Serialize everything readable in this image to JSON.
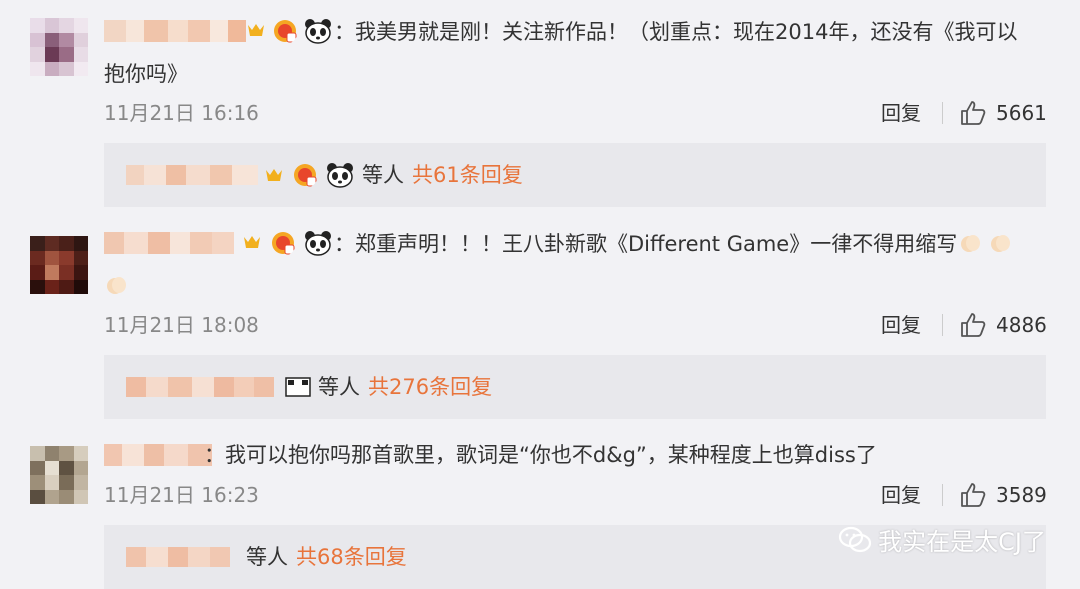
{
  "comments": [
    {
      "text_line1": "：我美男就是刚！关注新作品！（划重点：现在2014年，还没有《我可以",
      "text_line2": "抱你吗》",
      "time": "11月21日 16:16",
      "reply_label": "回复",
      "likes": "5661",
      "thread": {
        "deng": "等人",
        "total": "共61条回复"
      }
    },
    {
      "text_line1": "：郑重声明！！！王八卦新歌《Different Game》一律不得用缩写",
      "text_line2": "",
      "time": "11月21日 18:08",
      "reply_label": "回复",
      "likes": "4886",
      "thread": {
        "deng": "等人",
        "total": "共276条回复"
      }
    },
    {
      "text_line1": "：我可以抱你吗那首歌里，歌词是“你也不d&g”，某种程度上也算diss了",
      "text_line2": "",
      "time": "11月21日 16:23",
      "reply_label": "回复",
      "likes": "3589",
      "thread": {
        "deng": "等人",
        "total": "共68条回复"
      }
    }
  ],
  "watermark": {
    "text": "我实在是太CJ了",
    "icon": "wechat-icon"
  },
  "colors": {
    "accent": "#e8743b",
    "background": "#f2f2f5",
    "reply_box": "#e8e8ec",
    "time": "#888888"
  }
}
